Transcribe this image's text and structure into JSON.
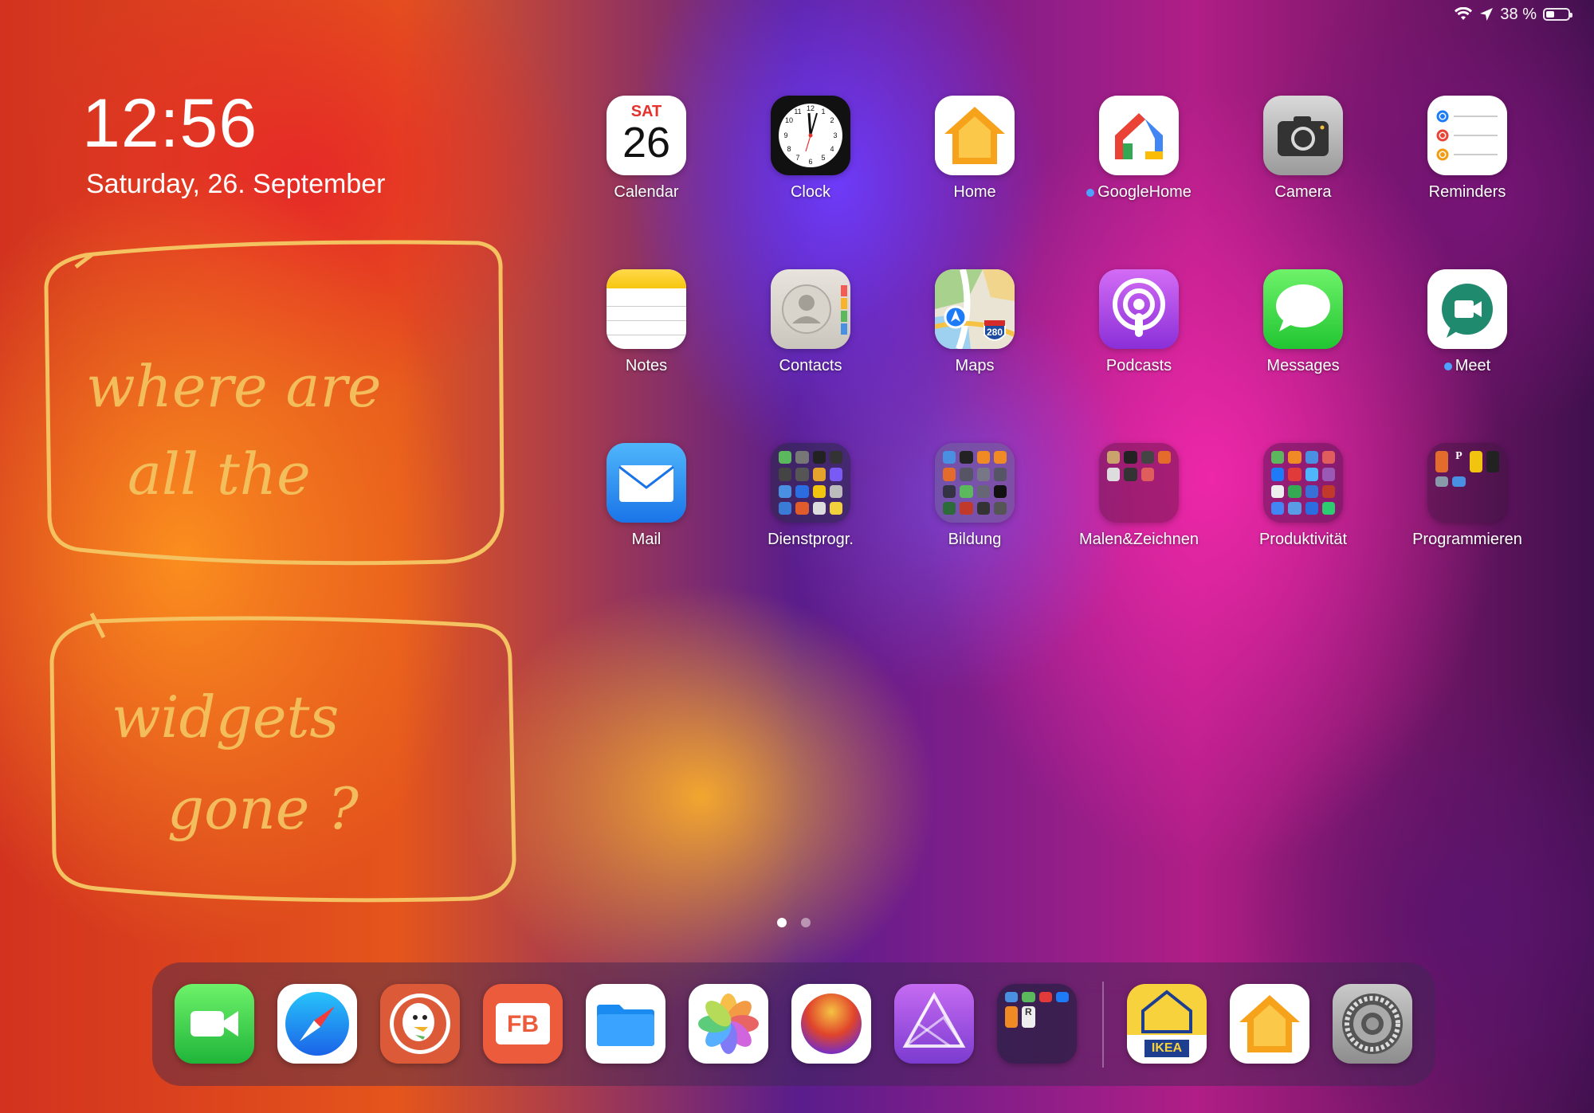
{
  "status_bar": {
    "battery_text": "38 %",
    "battery_level": 0.38
  },
  "lock_info": {
    "time": "12:56",
    "date": "Saturday, 26. September"
  },
  "note": {
    "line1": "where are",
    "line2": "all the",
    "line3": "widgets",
    "line4": "gone ?"
  },
  "apps": [
    {
      "id": "calendar",
      "label": "Calendar",
      "cal_day": "SAT",
      "cal_date": "26"
    },
    {
      "id": "clock",
      "label": "Clock"
    },
    {
      "id": "home",
      "label": "Home"
    },
    {
      "id": "googlehome",
      "label": "GoogleHome"
    },
    {
      "id": "camera",
      "label": "Camera"
    },
    {
      "id": "reminders",
      "label": "Reminders"
    },
    {
      "id": "notes",
      "label": "Notes"
    },
    {
      "id": "contacts",
      "label": "Contacts"
    },
    {
      "id": "maps",
      "label": "Maps",
      "shield": "280"
    },
    {
      "id": "podcasts",
      "label": "Podcasts"
    },
    {
      "id": "messages",
      "label": "Messages"
    },
    {
      "id": "meet",
      "label": "Meet"
    },
    {
      "id": "mail",
      "label": "Mail"
    },
    {
      "id": "dienstprogr",
      "label": "Dienstprogr."
    },
    {
      "id": "bildung",
      "label": "Bildung"
    },
    {
      "id": "malen",
      "label": "Malen&Zeichnen"
    },
    {
      "id": "produktivitaet",
      "label": "Produktivität"
    },
    {
      "id": "programmieren",
      "label": "Programmieren",
      "mini_text": "P"
    }
  ],
  "dock": {
    "apps": [
      {
        "id": "facetime"
      },
      {
        "id": "safari"
      },
      {
        "id": "duckduckgo"
      },
      {
        "id": "filebrowser",
        "text": "FB"
      },
      {
        "id": "files"
      },
      {
        "id": "photos"
      },
      {
        "id": "color-wheel"
      },
      {
        "id": "affinity-photo"
      },
      {
        "id": "dock-folder",
        "mini_text": "R"
      },
      {
        "id": "ikea-home",
        "text": "IKEA"
      },
      {
        "id": "home-dock"
      },
      {
        "id": "settings"
      }
    ]
  },
  "colors": {
    "note_ink": "#f4c260",
    "dot_blue": "#4da3ff"
  }
}
